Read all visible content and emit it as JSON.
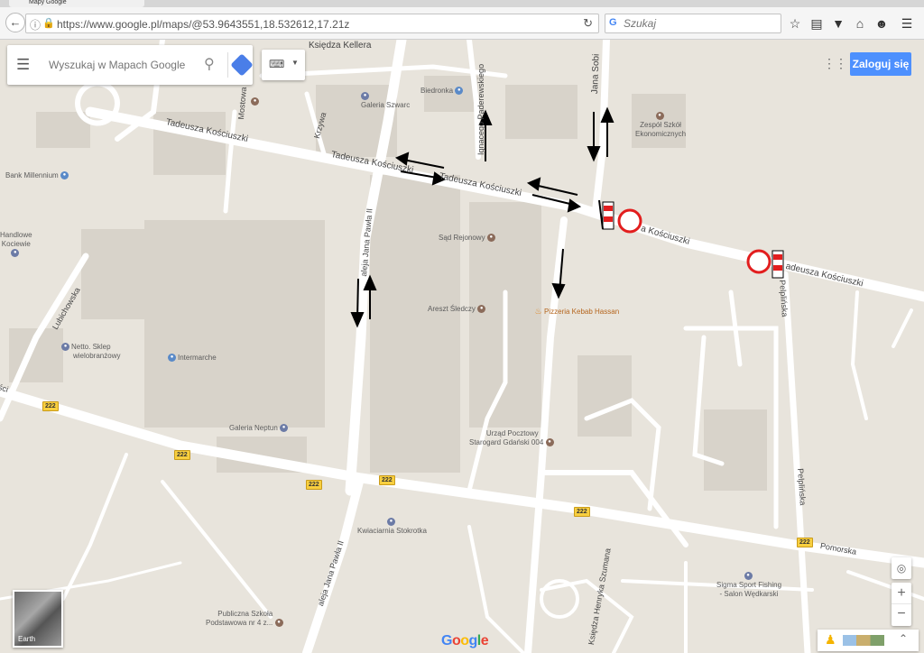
{
  "browser": {
    "tab_title": "Mapy Google",
    "url": "https://www.google.pl/maps/@53.9643551,18.532612,17.21z",
    "search_placeholder": "Szukaj",
    "back_icon": "back-arrow-icon",
    "toolbar_icons": [
      "bookmark-star-icon",
      "reading-list-icon",
      "pocket-icon",
      "home-icon",
      "emoji-icon",
      "menu-icon"
    ]
  },
  "maps_ui": {
    "search_placeholder": "Wyszukaj w Mapach Google",
    "login_label": "Zaloguj się",
    "earth_label": "Earth",
    "logo": "Google",
    "zoom_in": "+",
    "zoom_out": "−"
  },
  "streets": {
    "ksiedza_kellera": "Księdza Kellera",
    "kosciuszki_1": "Tadeusza Kościuszki",
    "kosciuszki_2": "Tadeusza Kościuszki",
    "kosciuszki_3": "Tadeusza Kościuszki",
    "kosciuszki_4": "a Kościuszki",
    "kosciuszki_5": "adeusza Kościuszki",
    "jana_sob": "Jana Sobi",
    "paderewskiego": "Ignacego Paderewskiego",
    "krzywa": "Krzywa",
    "mostowa": "Mostowa",
    "jana_pawla_1": "aleja Jana Pawła II",
    "jana_pawla_2": "aleja Jana Pawła II",
    "lubichowska": "Lubichowska",
    "pelplinska_1": "Pelplińska",
    "pelplinska_2": "Pelplińska",
    "pomorska": "Pomorska",
    "szumana": "Księdza Henryka Szumana",
    "left_edge": "ści"
  },
  "pois": {
    "biedronka": "Biedronka",
    "galeria_szwarc": "Galeria Szwarc",
    "zespol_szkol": [
      "Zespół Szkół",
      "Ekonomicznych"
    ],
    "bank_millennium": "Bank Millennium",
    "handlowe_kociewie": [
      "Handlowe",
      "Kociewie"
    ],
    "sad_rejonowy": "Sąd Rejonowy",
    "areszt": "Areszt Śledczy",
    "pizzeria": "Pizzeria Kebab Hassan",
    "netto": [
      "Netto. Sklep",
      "wielobranżowy"
    ],
    "intermarche": "Intermarche",
    "galeria_neptun": "Galeria Neptun",
    "urzad_pocztowy": [
      "Urząd Pocztowy",
      "Starogard Gdański 004"
    ],
    "kwiaciarnia": "Kwiaciarnia Stokrotka",
    "sigma": [
      "Sigma Sport Fishing",
      "- Salon Wędkarski"
    ],
    "szkola": [
      "Publiczna Szkoła",
      "Podstawowa nr 4 z..."
    ]
  },
  "route_badges": [
    "222",
    "222",
    "222",
    "222",
    "222",
    "222"
  ],
  "colors": {
    "map_bg": "#e8e4dc",
    "road": "#ffffff",
    "building": "#d8d3ca",
    "route_shield": "#f8cf3f",
    "accent_blue": "#4d90fe",
    "no_entry_red": "#e21e1e"
  },
  "icons": {
    "menu": "hamburger-menu-icon",
    "search": "magnifier-icon",
    "directions": "directions-icon",
    "keyboard": "keyboard-icon",
    "apps": "apps-grid-icon",
    "compass": "my-location-icon",
    "pegman": "pegman-icon",
    "expand": "expand-chevrons-icon"
  }
}
